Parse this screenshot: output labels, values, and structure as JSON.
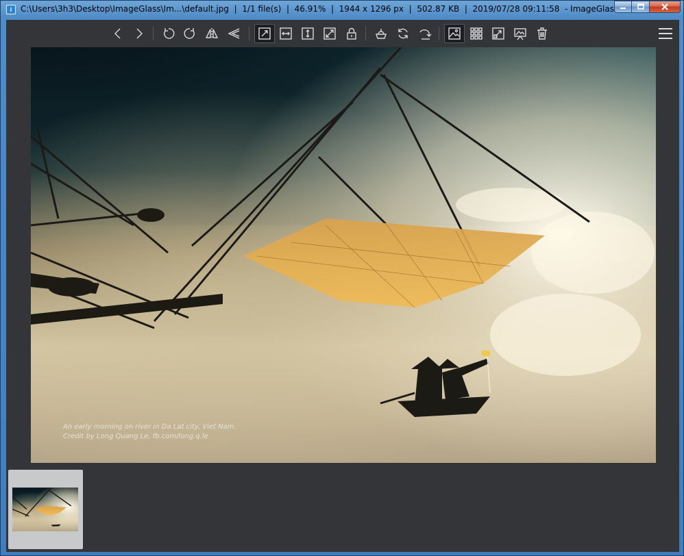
{
  "window": {
    "title": "C:\\Users\\3h3\\Desktop\\ImageGlass\\Im...\\default.jpg  |  1/1 file(s)  |  46.91%  |  1944 x 1296 px  |  502.87 KB  |  2019/07/28 09:11:58  - ImageGlass",
    "icon": "imageglass-app-icon",
    "controls": [
      "minimize",
      "maximize",
      "close"
    ]
  },
  "toolbar": {
    "buttons": [
      {
        "name": "previous-image",
        "icon": "chevron-left-icon"
      },
      {
        "name": "next-image",
        "icon": "chevron-right-icon"
      },
      {
        "name": "rotate-left",
        "icon": "rotate-left-icon"
      },
      {
        "name": "rotate-right",
        "icon": "rotate-right-icon"
      },
      {
        "name": "flip-horizontal",
        "icon": "flip-horizontal-icon"
      },
      {
        "name": "flip-vertical",
        "icon": "flip-vertical-icon"
      },
      {
        "name": "auto-zoom",
        "icon": "auto-zoom-icon",
        "active": true
      },
      {
        "name": "scale-to-width",
        "icon": "scale-width-icon"
      },
      {
        "name": "scale-to-height",
        "icon": "scale-height-icon"
      },
      {
        "name": "scale-to-fit",
        "icon": "scale-fit-icon"
      },
      {
        "name": "lock-zoom",
        "icon": "lock-icon"
      },
      {
        "name": "open-with",
        "icon": "open-with-icon"
      },
      {
        "name": "refresh",
        "icon": "refresh-icon"
      },
      {
        "name": "go-to-image",
        "icon": "goto-icon"
      },
      {
        "name": "thumbnail-bar",
        "icon": "thumbnail-icon",
        "active": true
      },
      {
        "name": "gallery-grid",
        "icon": "grid-icon"
      },
      {
        "name": "fullscreen",
        "icon": "fullscreen-icon"
      },
      {
        "name": "slideshow",
        "icon": "slideshow-icon"
      },
      {
        "name": "delete",
        "icon": "trash-icon"
      }
    ],
    "menu_icon": "hamburger-menu-icon"
  },
  "viewer": {
    "caption_line1": "An early morning on river in Da Lat city, Viet Nam.",
    "caption_line2": "Credit by Long Quang Le, fb.com/long.q.le"
  },
  "colors": {
    "background": "#333539",
    "icon": "#d9dadc",
    "thumb_selected": "#c8c9cb"
  }
}
